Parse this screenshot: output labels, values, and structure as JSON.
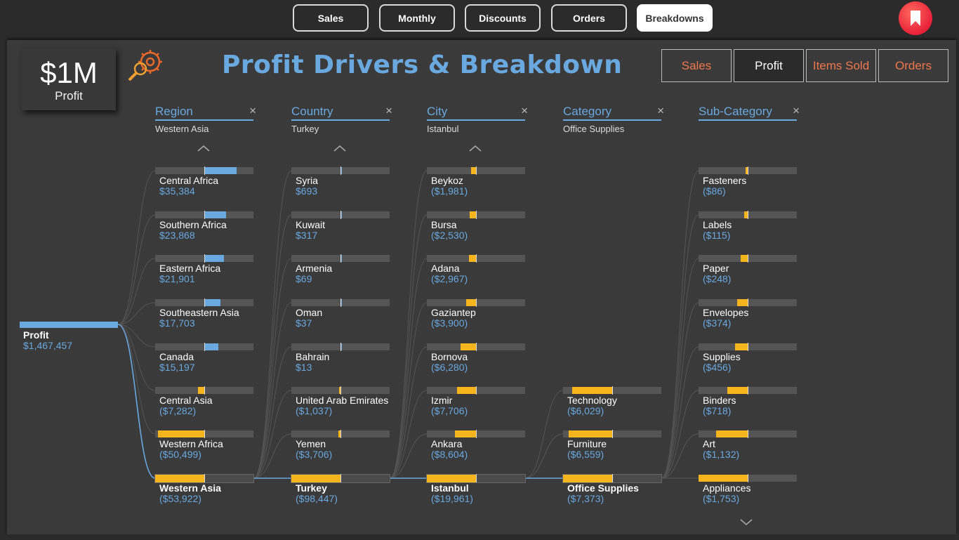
{
  "nav": {
    "tabs": [
      {
        "label": "Sales",
        "active": false
      },
      {
        "label": "Monthly",
        "active": false
      },
      {
        "label": "Discounts",
        "active": false
      },
      {
        "label": "Orders",
        "active": false
      },
      {
        "label": "Breakdowns",
        "active": true
      }
    ],
    "bookmark_icon": "bookmark-icon"
  },
  "kpi": {
    "value": "$1M",
    "label": "Profit"
  },
  "title": "Profit Drivers & Breakdown",
  "metric_buttons": [
    {
      "label": "Sales",
      "active": false
    },
    {
      "label": "Profit",
      "active": true
    },
    {
      "label": "Items Sold",
      "active": false
    },
    {
      "label": "Orders",
      "active": false
    }
  ],
  "colors": {
    "positive": "#6aa8e0",
    "negative": "#f6b51c",
    "accent": "#f0774e"
  },
  "root": {
    "label": "Profit",
    "value": "$1,467,457"
  },
  "columns": [
    {
      "name": "Region",
      "filter": "Western Asia",
      "show_up": true,
      "show_down": false,
      "nodes": [
        {
          "label": "Central Africa",
          "value": "$35,384",
          "amount": 35384
        },
        {
          "label": "Southern Africa",
          "value": "$23,868",
          "amount": 23868
        },
        {
          "label": "Eastern Africa",
          "value": "$21,901",
          "amount": 21901
        },
        {
          "label": "Southeastern Asia",
          "value": "$17,703",
          "amount": 17703
        },
        {
          "label": "Canada",
          "value": "$15,197",
          "amount": 15197
        },
        {
          "label": "Central Asia",
          "value": "($7,282)",
          "amount": -7282
        },
        {
          "label": "Western Africa",
          "value": "($50,499)",
          "amount": -50499
        },
        {
          "label": "Western Asia",
          "value": "($53,922)",
          "amount": -53922,
          "selected": true
        }
      ]
    },
    {
      "name": "Country",
      "filter": "Turkey",
      "show_up": true,
      "show_down": false,
      "nodes": [
        {
          "label": "Syria",
          "value": "$693",
          "amount": 693
        },
        {
          "label": "Kuwait",
          "value": "$317",
          "amount": 317
        },
        {
          "label": "Armenia",
          "value": "$69",
          "amount": 69
        },
        {
          "label": "Oman",
          "value": "$37",
          "amount": 37
        },
        {
          "label": "Bahrain",
          "value": "$13",
          "amount": 13
        },
        {
          "label": "United Arab Emirates",
          "value": "($1,037)",
          "amount": -1037
        },
        {
          "label": "Yemen",
          "value": "($3,706)",
          "amount": -3706
        },
        {
          "label": "Turkey",
          "value": "($98,447)",
          "amount": -98447,
          "selected": true
        }
      ]
    },
    {
      "name": "City",
      "filter": "Istanbul",
      "show_up": true,
      "show_down": false,
      "nodes": [
        {
          "label": "Beykoz",
          "value": "($1,981)",
          "amount": -1981
        },
        {
          "label": "Bursa",
          "value": "($2,530)",
          "amount": -2530
        },
        {
          "label": "Adana",
          "value": "($2,967)",
          "amount": -2967
        },
        {
          "label": "Gaziantep",
          "value": "($3,900)",
          "amount": -3900
        },
        {
          "label": "Bornova",
          "value": "($6,280)",
          "amount": -6280
        },
        {
          "label": "Izmir",
          "value": "($7,706)",
          "amount": -7706
        },
        {
          "label": "Ankara",
          "value": "($8,604)",
          "amount": -8604
        },
        {
          "label": "Istanbul",
          "value": "($19,961)",
          "amount": -19961,
          "selected": true
        }
      ]
    },
    {
      "name": "Category",
      "filter": "Office Supplies",
      "show_up": false,
      "show_down": false,
      "nodes": [
        {
          "label": "Technology",
          "value": "($6,029)",
          "amount": -6029
        },
        {
          "label": "Furniture",
          "value": "($6,559)",
          "amount": -6559
        },
        {
          "label": "Office Supplies",
          "value": "($7,373)",
          "amount": -7373,
          "selected": true
        }
      ]
    },
    {
      "name": "Sub-Category",
      "filter": "",
      "show_up": false,
      "show_down": true,
      "nodes": [
        {
          "label": "Fasteners",
          "value": "($86)",
          "amount": -86
        },
        {
          "label": "Labels",
          "value": "($115)",
          "amount": -115
        },
        {
          "label": "Paper",
          "value": "($248)",
          "amount": -248
        },
        {
          "label": "Envelopes",
          "value": "($374)",
          "amount": -374
        },
        {
          "label": "Supplies",
          "value": "($456)",
          "amount": -456
        },
        {
          "label": "Binders",
          "value": "($718)",
          "amount": -718
        },
        {
          "label": "Art",
          "value": "($1,132)",
          "amount": -1132
        },
        {
          "label": "Appliances",
          "value": "($1,753)",
          "amount": -1753
        }
      ]
    }
  ]
}
